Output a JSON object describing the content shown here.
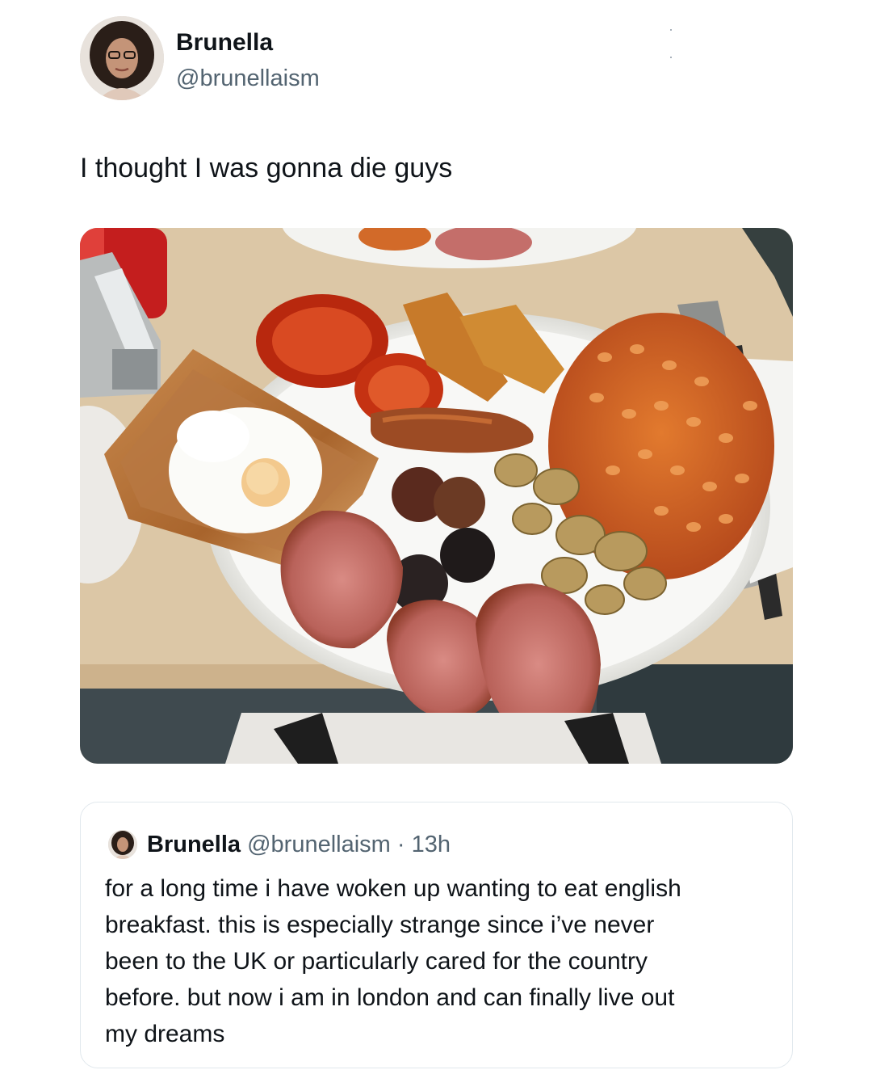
{
  "author": {
    "name": "Brunella",
    "handle": "@brunellaism"
  },
  "tweet": {
    "text": "I thought I was gonna die guys"
  },
  "quoted_tweet": {
    "name": "Brunella",
    "handle": "@brunellaism",
    "separator": "·",
    "time": "13h",
    "lines": [
      "for a long time i have woken up wanting to eat english",
      "breakfast. this is especially strange since i’ve never",
      "been to the UK or particularly cared for the country",
      "before.  but now i am in london and can finally live out",
      "my dreams"
    ]
  },
  "icons": {
    "more": "more-options-icon"
  }
}
